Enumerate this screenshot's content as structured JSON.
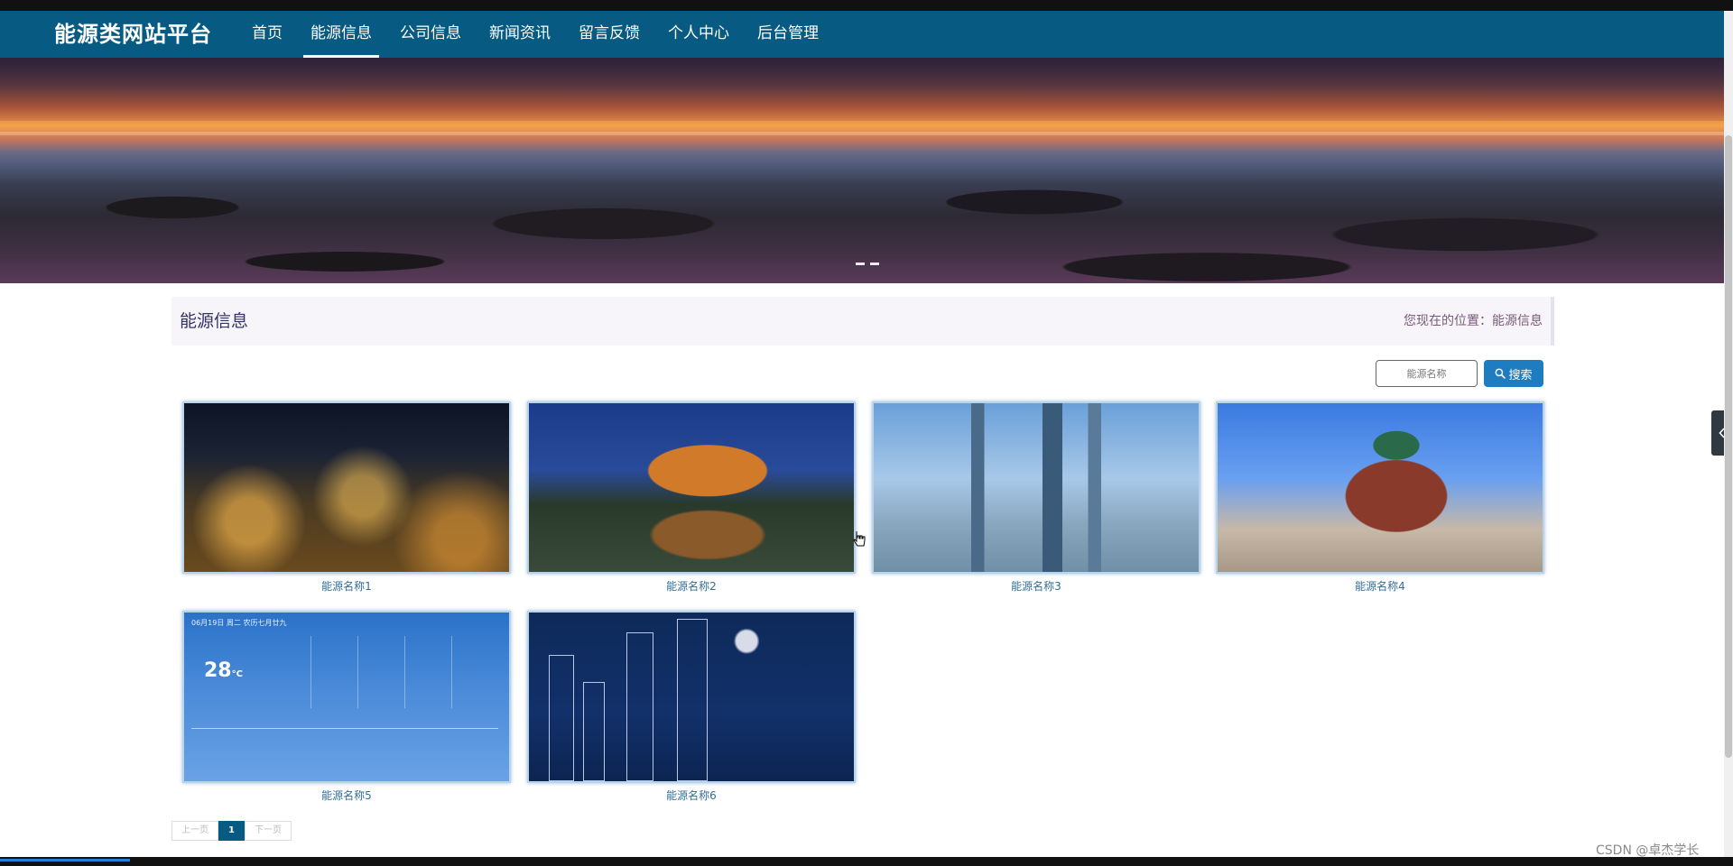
{
  "header": {
    "brand": "能源类网站平台",
    "nav": [
      {
        "label": "首页",
        "active": false
      },
      {
        "label": "能源信息",
        "active": true
      },
      {
        "label": "公司信息",
        "active": false
      },
      {
        "label": "新闻资讯",
        "active": false
      },
      {
        "label": "留言反馈",
        "active": false
      },
      {
        "label": "个人中心",
        "active": false
      },
      {
        "label": "后台管理",
        "active": false
      }
    ]
  },
  "section": {
    "title": "能源信息",
    "breadcrumb": "您现在的位置：能源信息"
  },
  "search": {
    "placeholder": "能源名称",
    "button_label": "搜索"
  },
  "items": [
    {
      "name": "能源名称1",
      "image": "night-city-skyline"
    },
    {
      "name": "能源名称2",
      "image": "pagoda-bridge-night"
    },
    {
      "name": "能源名称3",
      "image": "city-skyline-river"
    },
    {
      "name": "能源名称4",
      "image": "cathedral-square"
    },
    {
      "name": "能源名称5",
      "image": "weather-forecast-screenshot"
    },
    {
      "name": "能源名称6",
      "image": "line-art-city-night"
    }
  ],
  "weather_card": {
    "header": "06月19日 周二 农历七月廿九",
    "temperature": "28",
    "unit": "°C"
  },
  "pagination": {
    "prev": "上一页",
    "current": "1",
    "next": "下一页"
  },
  "watermark": "CSDN @卓杰学长",
  "colors": {
    "nav_bg": "#075a82",
    "accent": "#1e7cc0",
    "label": "#336e96"
  }
}
